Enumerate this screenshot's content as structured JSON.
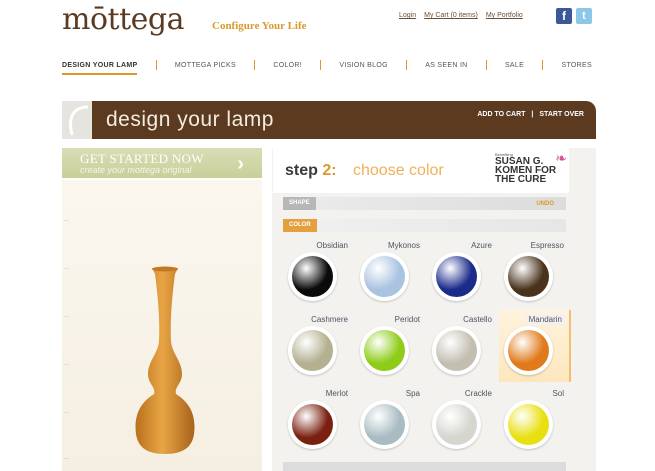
{
  "header": {
    "logo": "mōttega",
    "tagline": "Configure Your Life",
    "links": [
      "Login",
      "My Cart (0 items)",
      "My Portfolio"
    ],
    "social": [
      {
        "name": "facebook-icon",
        "glyph": "f"
      },
      {
        "name": "twitter-icon",
        "glyph": "t"
      }
    ]
  },
  "nav": {
    "items": [
      "DESIGN YOUR LAMP",
      "MOTTEGA PICKS",
      "COLOR!",
      "VISION BLOG",
      "AS SEEN IN",
      "SALE",
      "STORES"
    ],
    "active_index": 0
  },
  "banner": {
    "title": "design your lamp",
    "add_to_cart": "ADD TO CART",
    "separator": "|",
    "start_over": "START OVER"
  },
  "get_started": {
    "title": "GET STARTED NOW",
    "subtitle": "create your mottega original",
    "arrow": "›"
  },
  "step": {
    "label": "step",
    "number": "2:",
    "title": "choose color",
    "sponsor_small": "Benefiting",
    "sponsor_name": "SUSAN G. KOMEN FOR THE CURE",
    "shape_tab": "SHAPE",
    "undo": "UNDO",
    "color_tab": "COLOR"
  },
  "colors": [
    {
      "name": "Obsidian",
      "hex": "#0b0b0c"
    },
    {
      "name": "Mykonos",
      "hex": "#a9c3e0"
    },
    {
      "name": "Azure",
      "hex": "#1b2b8a"
    },
    {
      "name": "Espresso",
      "hex": "#4a331c"
    },
    {
      "name": "Cashmere",
      "hex": "#b4b090"
    },
    {
      "name": "Peridot",
      "hex": "#8fcc1a"
    },
    {
      "name": "Castello",
      "hex": "#c3beb2"
    },
    {
      "name": "Mandarin",
      "hex": "#e07a1a"
    },
    {
      "name": "Merlot",
      "hex": "#7a2010"
    },
    {
      "name": "Spa",
      "hex": "#a9bcc2"
    },
    {
      "name": "Crackle",
      "hex": "#d6d6cf"
    },
    {
      "name": "Sol",
      "hex": "#e8e010"
    }
  ],
  "selected_color_index": 7,
  "lamp": {
    "color": "#d88c2c"
  }
}
